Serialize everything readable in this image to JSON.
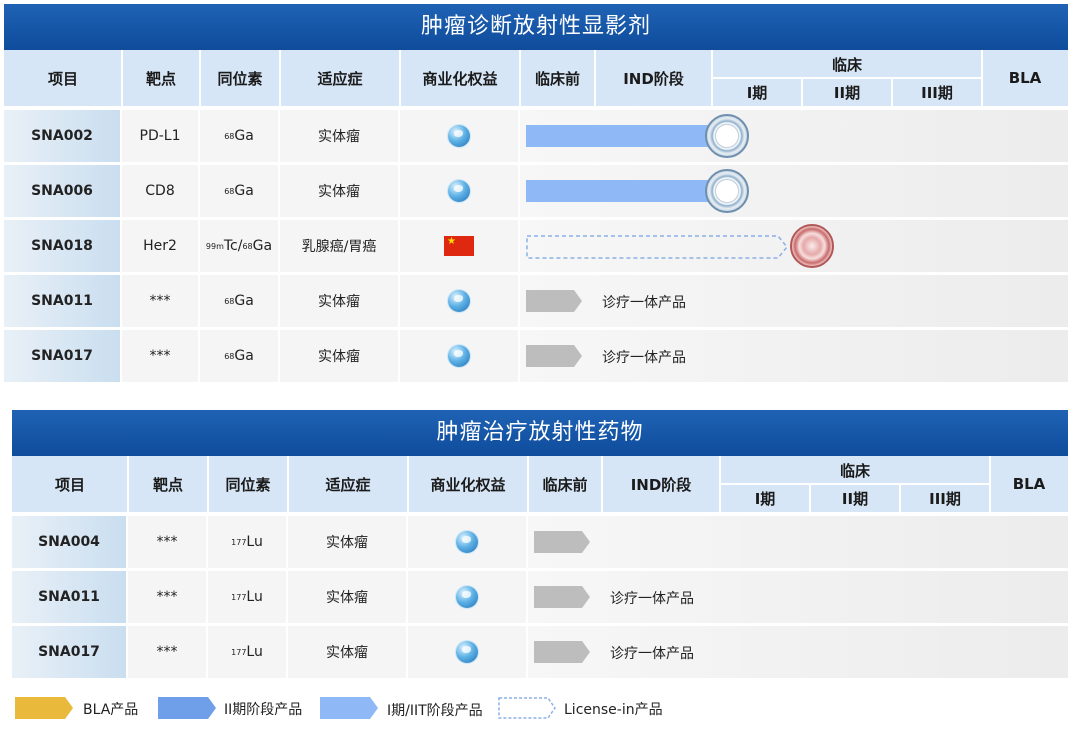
{
  "colors": {
    "title_bar": "#1558a8",
    "header": "#d6e6f6",
    "bla": "#e8b93a",
    "phase2": "#6e9fe8",
    "phase1": "#8fb8f7",
    "gray_arrow": "#bdbdbd",
    "license_dash": "#8ab0e6"
  },
  "headers": {
    "project": "项目",
    "target": "靶点",
    "isotope": "同位素",
    "indication": "适应症",
    "rights": "商业化权益",
    "preclinical": "临床前",
    "ind": "IND阶段",
    "clinical": "临床",
    "phase1": "I期",
    "phase2": "II期",
    "phase3": "III期",
    "bla": "BLA"
  },
  "imaging": {
    "title": "肿瘤诊断放射性显影剂",
    "rows": [
      {
        "project": "SNA002",
        "target": "PD-L1",
        "iso_sup": "68",
        "iso": "Ga",
        "indication": "实体瘤",
        "rights": "globe-icon",
        "bar": "phase1",
        "bar_label": "",
        "seal": "blue"
      },
      {
        "project": "SNA006",
        "target": "CD8",
        "iso_sup": "68",
        "iso": "Ga",
        "indication": "实体瘤",
        "rights": "globe-icon",
        "bar": "phase1",
        "bar_label": "",
        "seal": "blue"
      },
      {
        "project": "SNA018",
        "target": "Her2",
        "iso_sup": "99m",
        "iso": "Tc/",
        "iso_sup2": "68",
        "iso2": "Ga",
        "indication": "乳腺癌/胃癌",
        "rights": "china-flag-icon",
        "bar": "license",
        "bar_label": "",
        "seal": "red"
      },
      {
        "project": "SNA011",
        "target": "***",
        "iso_sup": "68",
        "iso": "Ga",
        "indication": "实体瘤",
        "rights": "globe-icon",
        "bar": "gray",
        "bar_label": "诊疗一体产品",
        "seal": ""
      },
      {
        "project": "SNA017",
        "target": "***",
        "iso_sup": "68",
        "iso": "Ga",
        "indication": "实体瘤",
        "rights": "globe-icon",
        "bar": "gray",
        "bar_label": "诊疗一体产品",
        "seal": ""
      }
    ]
  },
  "therapy": {
    "title": "肿瘤治疗放射性药物",
    "rows": [
      {
        "project": "SNA004",
        "target": "***",
        "iso_sup": "177",
        "iso": "Lu",
        "indication": "实体瘤",
        "rights": "globe-icon",
        "bar": "gray",
        "bar_label": ""
      },
      {
        "project": "SNA011",
        "target": "***",
        "iso_sup": "177",
        "iso": "Lu",
        "indication": "实体瘤",
        "rights": "globe-icon",
        "bar": "gray",
        "bar_label": "诊疗一体产品"
      },
      {
        "project": "SNA017",
        "target": "***",
        "iso_sup": "177",
        "iso": "Lu",
        "indication": "实体瘤",
        "rights": "globe-icon",
        "bar": "gray",
        "bar_label": "诊疗一体产品"
      }
    ]
  },
  "legend": [
    {
      "label": "BLA产品",
      "style": "bla"
    },
    {
      "label": "II期阶段产品",
      "style": "phase2"
    },
    {
      "label": "I期/IIT阶段产品",
      "style": "phase1"
    },
    {
      "label": "License-in产品",
      "style": "license"
    }
  ]
}
